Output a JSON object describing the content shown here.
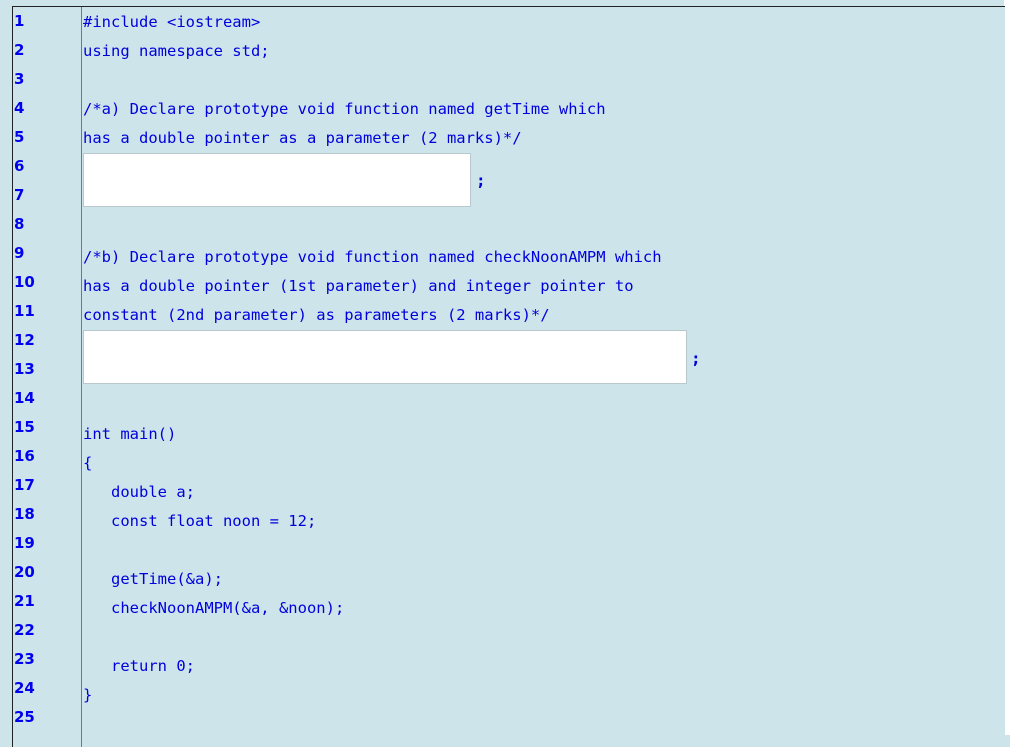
{
  "line_numbers": [
    "1",
    "2",
    "3",
    "4",
    "5",
    "6",
    "7",
    "8",
    "9",
    "10",
    "11",
    "12",
    "13",
    "14",
    "15",
    "16",
    "17",
    "18",
    "19",
    "20",
    "21",
    "22",
    "23",
    "24",
    "25"
  ],
  "code": {
    "include": "#include <iostream>",
    "using": "using namespace std;",
    "comment_a_1": "/*a) Declare prototype void function named getTime which",
    "comment_a_2": "has a double pointer as a parameter (2 marks)*/",
    "comment_b_1": "/*b) Declare prototype void function named checkNoonAMPM which",
    "comment_b_2": "has a double pointer (1st parameter) and integer pointer to",
    "comment_b_3": "constant (2nd parameter) as parameters (2 marks)*/",
    "main_sig": "int main()",
    "open_brace": "{",
    "decl_a": "   double a;",
    "decl_noon": "   const float noon = 12;",
    "call_gettime": "   getTime(&a);",
    "call_check": "   checkNoonAMPM(&a, &noon);",
    "return_stmt": "   return 0;",
    "close_brace": "}"
  },
  "answers": {
    "a": {
      "value": "",
      "suffix": ";"
    },
    "b": {
      "value": "",
      "suffix": ";"
    }
  }
}
